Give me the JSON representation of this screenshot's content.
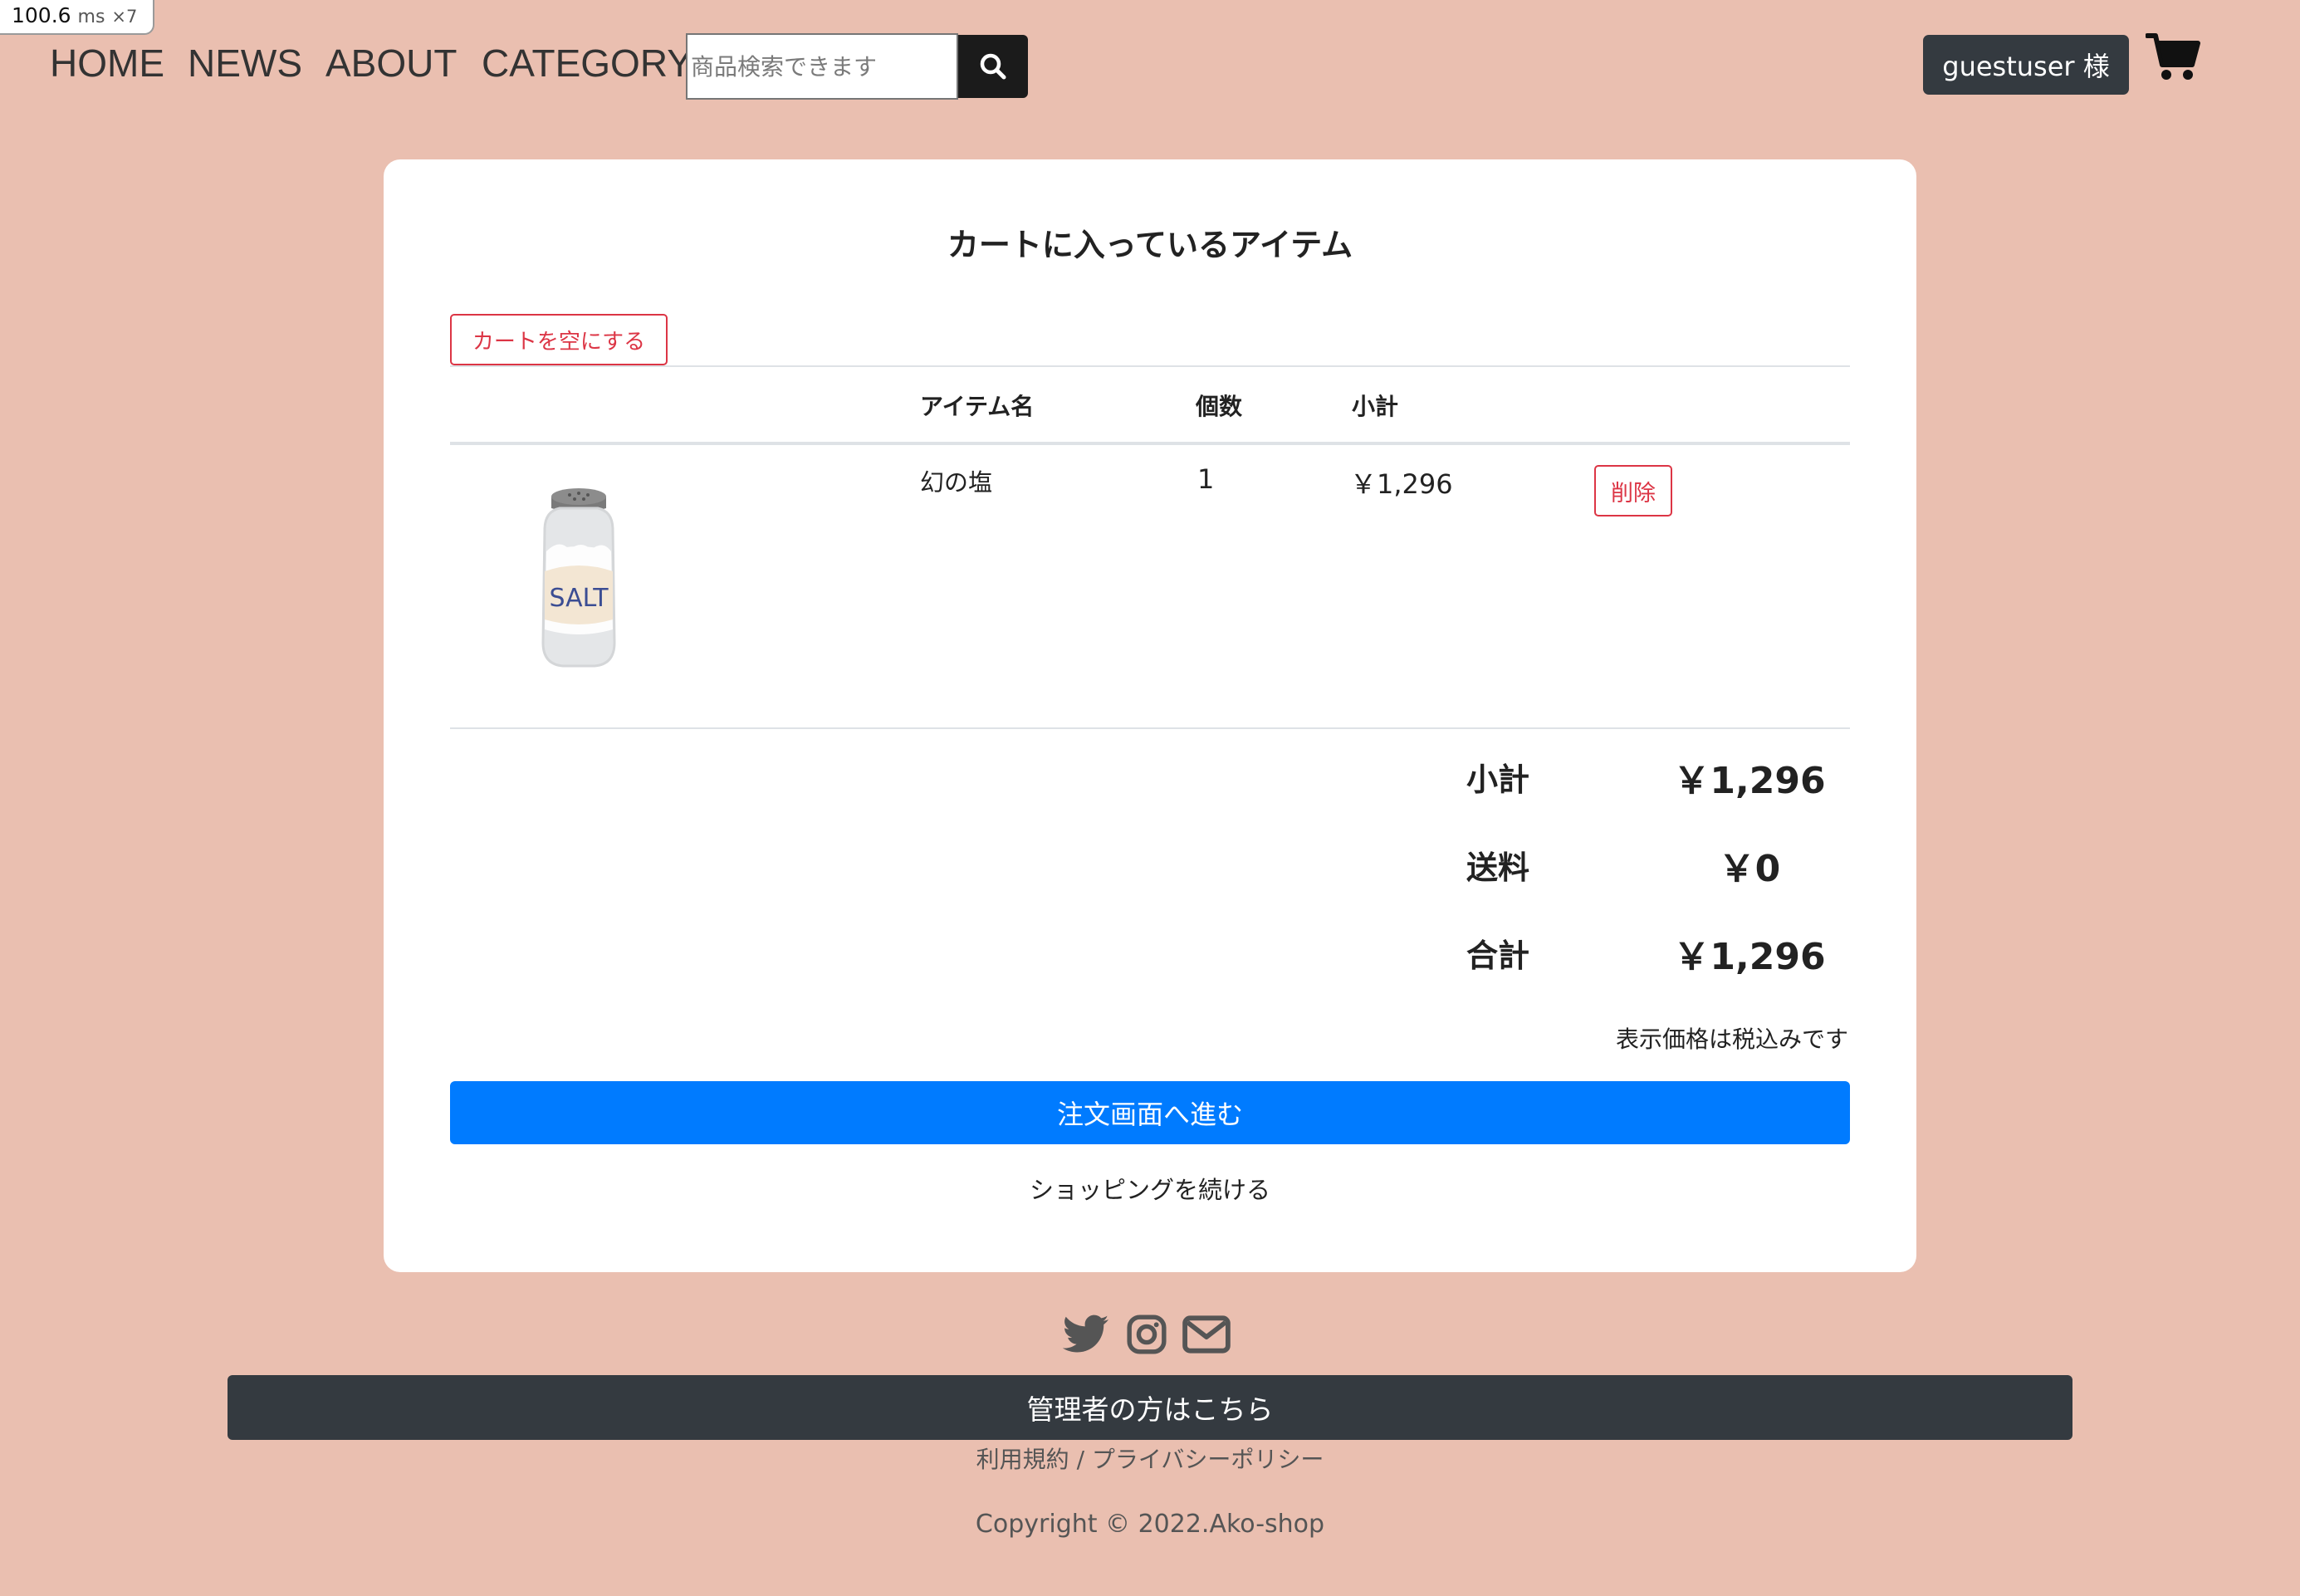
{
  "perf": {
    "value": "100.6",
    "unit": "ms",
    "multiplier": "×7"
  },
  "nav": {
    "home": "HOME",
    "news": "NEWS",
    "about": "ABOUT",
    "category": "CATEGORY",
    "search_placeholder": "商品検索できます",
    "search_icon": "search-icon",
    "user_label": "guestuser 様",
    "cart_icon": "shopping-cart-icon"
  },
  "cart": {
    "title": "カートに入っているアイテム",
    "empty_button": "カートを空にする",
    "columns": {
      "name": "アイテム名",
      "qty": "個数",
      "subtotal": "小計"
    },
    "items": [
      {
        "name": "幻の塩",
        "qty": "1",
        "subtotal": "￥1,296",
        "delete_label": "削除",
        "image_text": "SALT"
      }
    ],
    "summary": {
      "subtotal_label": "小計",
      "subtotal_value": "￥1,296",
      "shipping_label": "送料",
      "shipping_value": "￥0",
      "total_label": "合計",
      "total_value": "￥1,296"
    },
    "tax_note": "表示価格は税込みです",
    "order_button": "注文画面へ進む",
    "continue_link": "ショッピングを続ける"
  },
  "footer": {
    "social_icons": [
      "twitter-icon",
      "instagram-icon",
      "mail-icon"
    ],
    "admin_button": "管理者の方はこちら",
    "terms_link": "利用規約",
    "separator": "/",
    "privacy_link": "プライバシーポリシー",
    "copyright": "Copyright © 2022.Ako-shop"
  },
  "colors": {
    "background": "#eabfb0",
    "primary": "#007bff",
    "danger": "#dc3545",
    "dark": "#343a40"
  }
}
